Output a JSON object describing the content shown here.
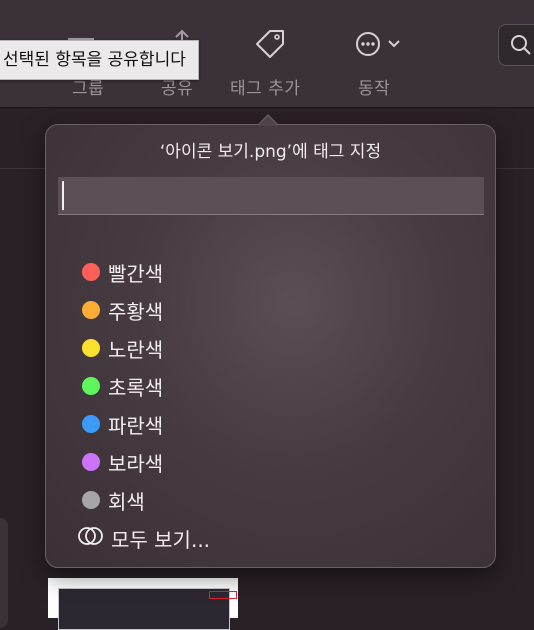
{
  "toolbar": {
    "items": [
      {
        "id": "group",
        "label": "그룹",
        "icon": "group-icon"
      },
      {
        "id": "share",
        "label": "공유",
        "icon": "share-icon"
      },
      {
        "id": "tag",
        "label": "태그 추가",
        "icon": "tag-icon"
      },
      {
        "id": "action",
        "label": "동작",
        "icon": "ellipsis-circle-icon"
      }
    ],
    "search_icon": "magnifying-glass-icon"
  },
  "tooltip": {
    "text": "선택된 항목을 공유합니다"
  },
  "popover": {
    "title": "‘아이콘 보기.png’에 태그 지정",
    "input_value": "",
    "tags": [
      {
        "label": "빨간색",
        "color": "#fe5f57"
      },
      {
        "label": "주황색",
        "color": "#fdad36"
      },
      {
        "label": "노란색",
        "color": "#fde12f"
      },
      {
        "label": "초록색",
        "color": "#5ef55e"
      },
      {
        "label": "파란색",
        "color": "#3a9bfb"
      },
      {
        "label": "보라색",
        "color": "#cb73fa"
      },
      {
        "label": "회색",
        "color": "#a8a5a8"
      }
    ],
    "show_all_label": "모두 보기..."
  },
  "colors": {
    "toolbar_bg": "#3a3238",
    "window_bg": "#2a2128",
    "popover_bg": "#4e4349",
    "tooltip_bg": "#ece9eb"
  }
}
